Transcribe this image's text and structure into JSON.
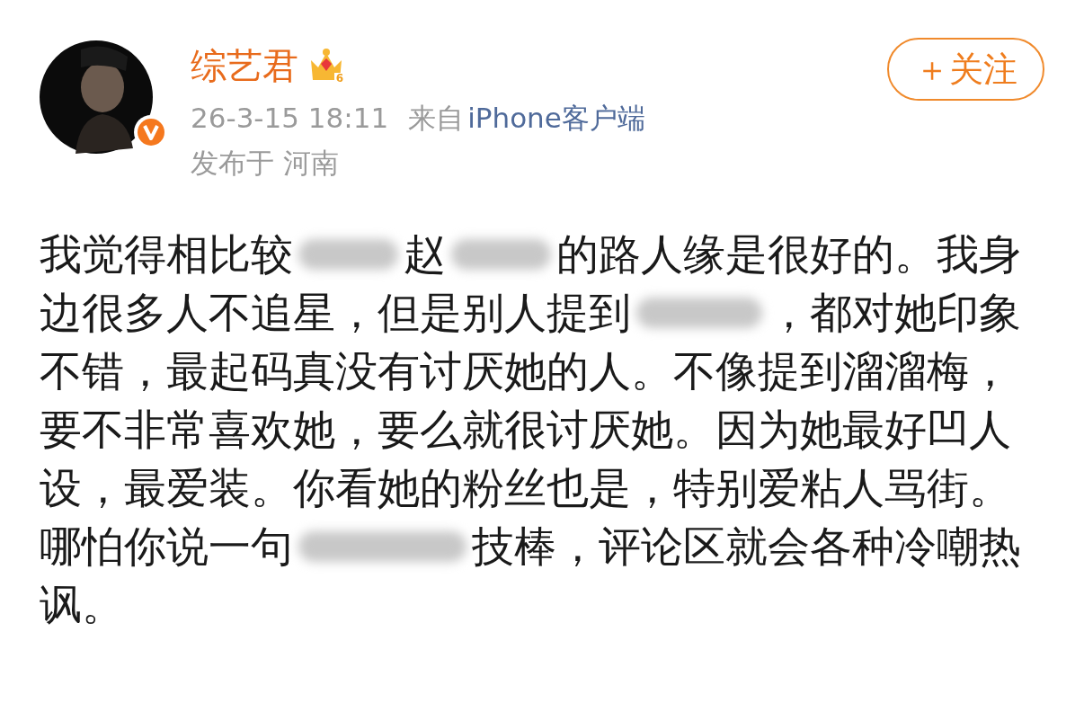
{
  "post": {
    "author": {
      "name": "综艺君",
      "verified": true,
      "badge_level": "6"
    },
    "time": "26-3-15 18:11",
    "source_prefix": "来自",
    "source": "iPhone客户端",
    "location": "发布于 河南",
    "follow_button": "＋关注",
    "body_lines": [
      [
        {
          "kind": "text",
          "text": "我觉得相比较"
        },
        {
          "kind": "blur"
        },
        {
          "kind": "text",
          "text": "赵"
        },
        {
          "kind": "blur"
        },
        {
          "kind": "text",
          "text": "的路人缘是很好的。我身"
        }
      ],
      [
        {
          "kind": "text",
          "text": "边很多人不追星，但是别人提到"
        },
        {
          "kind": "blur"
        },
        {
          "kind": "text",
          "text": "，都对她印象"
        }
      ],
      [
        {
          "kind": "text",
          "text": "不错，最起码真没有讨厌她的人。不像提到溜溜梅，"
        }
      ],
      [
        {
          "kind": "text",
          "text": "要不非常喜欢她，要么就很讨厌她。因为她最好凹人"
        }
      ],
      [
        {
          "kind": "text",
          "text": "设，最爱装。你看她的粉丝也是，特别爱粘人骂街。"
        }
      ],
      [
        {
          "kind": "text",
          "text": "哪怕你说一句"
        },
        {
          "kind": "blur"
        },
        {
          "kind": "text",
          "text": "技棒，评论区就会各种冷嘲热"
        }
      ],
      [
        {
          "kind": "text",
          "text": "讽。"
        }
      ]
    ]
  }
}
